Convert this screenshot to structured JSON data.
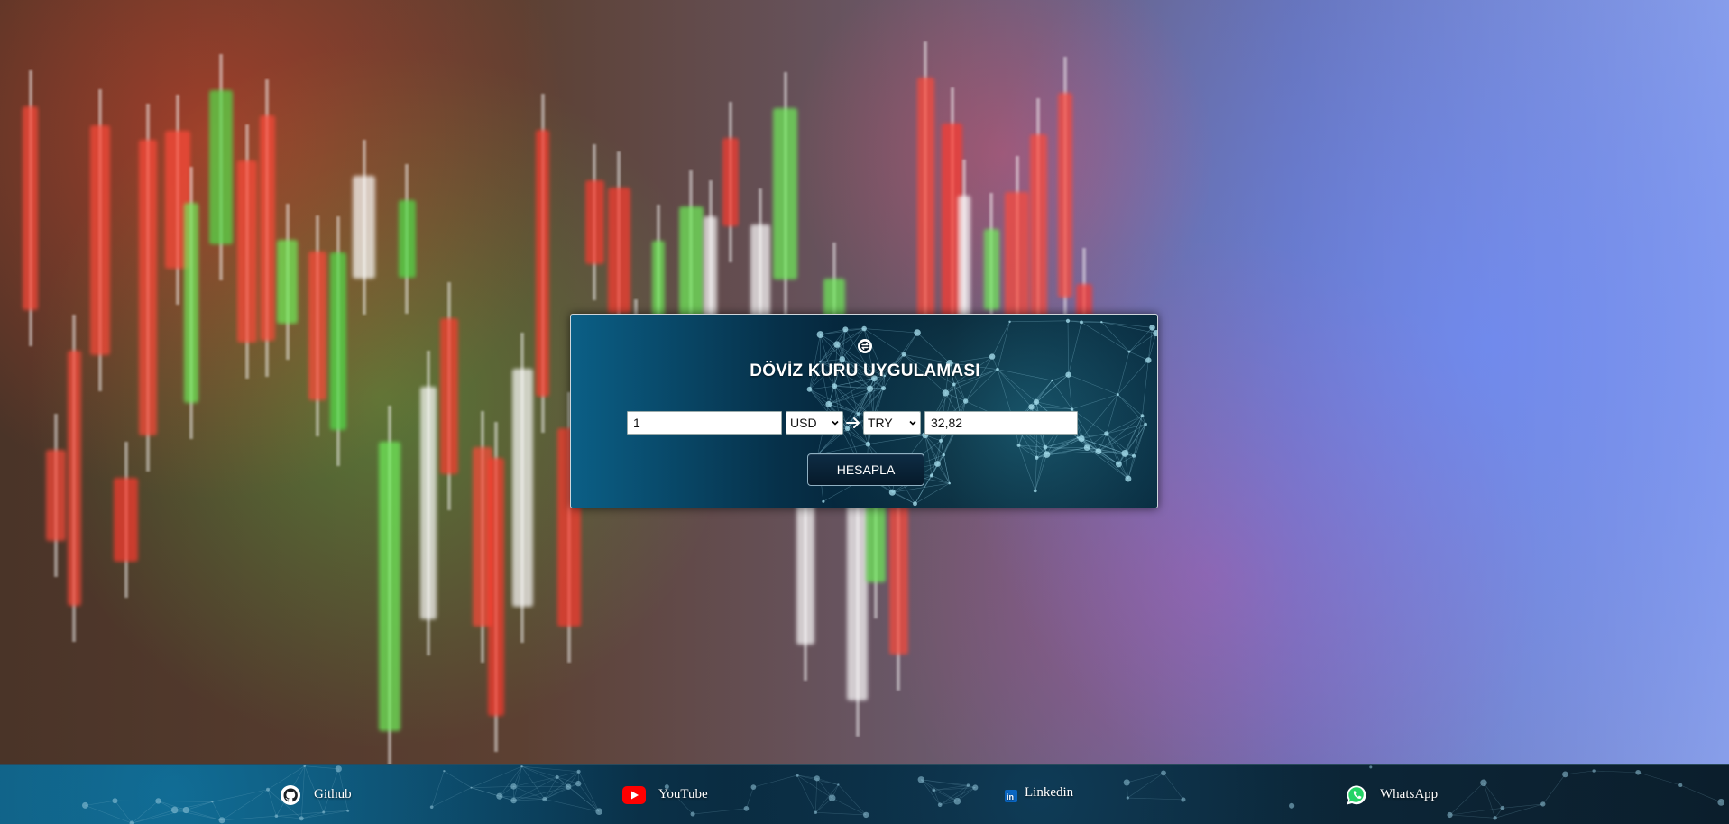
{
  "app": {
    "title": "DÖVİZ KURU UYGULAMASI"
  },
  "converter": {
    "amount_value": "1",
    "from_currency": "USD",
    "to_currency": "TRY",
    "result_value": "32,82",
    "calculate_label": "HESAPLA",
    "logo_icon": "currency-exchange-icon",
    "arrow_icon": "arrow-right-icon"
  },
  "footer": {
    "links": [
      {
        "label": "Github",
        "icon": "github-icon"
      },
      {
        "label": "YouTube",
        "icon": "youtube-icon"
      },
      {
        "label": "Linkedin",
        "icon": "linkedin-icon"
      },
      {
        "label": "WhatsApp",
        "icon": "whatsapp-icon"
      }
    ]
  },
  "colors": {
    "card_dark": "#041726",
    "card_accent": "#0b5f86",
    "youtube_red": "#ff0000",
    "linkedin_blue": "#0a66c2"
  }
}
